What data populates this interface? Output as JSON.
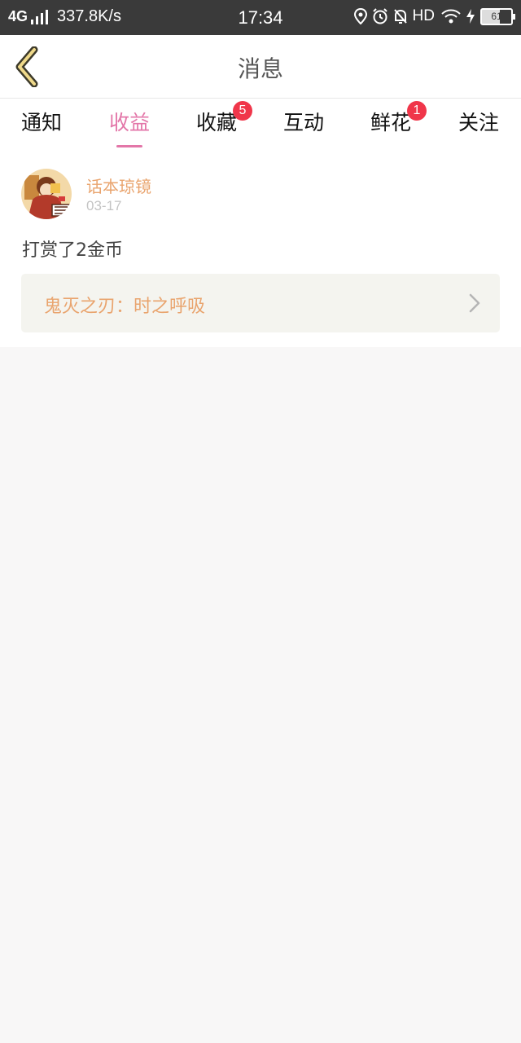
{
  "status_bar": {
    "network": "4G",
    "speed": "337.8K/s",
    "time": "17:34",
    "hd": "HD",
    "battery": "61"
  },
  "header": {
    "title": "消息"
  },
  "tabs": [
    {
      "label": "通知",
      "active": false
    },
    {
      "label": "收益",
      "active": true
    },
    {
      "label": "收藏",
      "active": false,
      "badge": "5"
    },
    {
      "label": "互动",
      "active": false
    },
    {
      "label": "鲜花",
      "active": false,
      "badge": "1"
    },
    {
      "label": "关注",
      "active": false
    }
  ],
  "message": {
    "sender": "话本琼镜",
    "date": "03-17",
    "text": "打赏了2金币",
    "book_title": "鬼灭之刃：时之呼吸"
  },
  "colors": {
    "accent": "#e376a8",
    "badge": "#f0364a",
    "name_orange": "#e9a46e"
  }
}
